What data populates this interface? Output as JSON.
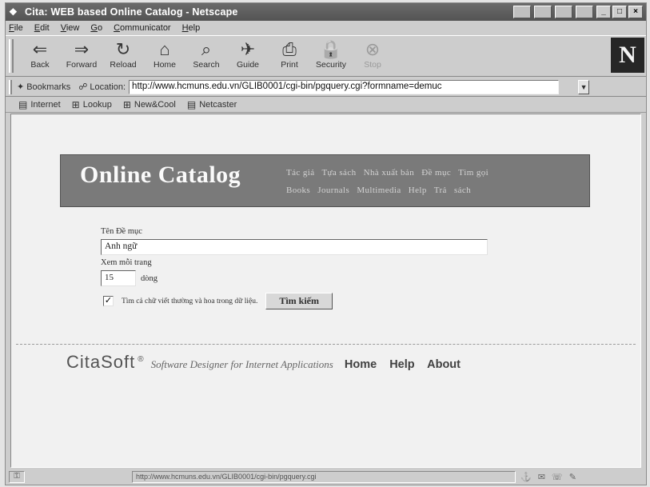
{
  "window": {
    "title": "Cita: WEB based Online Catalog - Netscape"
  },
  "menu": [
    "File",
    "Edit",
    "View",
    "Go",
    "Communicator",
    "Help"
  ],
  "toolbar": {
    "buttons": [
      {
        "label": "Back",
        "icon": "back-arrow-icon",
        "glyph": "⇐"
      },
      {
        "label": "Forward",
        "icon": "forward-arrow-icon",
        "glyph": "⇒"
      },
      {
        "label": "Reload",
        "icon": "reload-icon",
        "glyph": "↻"
      },
      {
        "label": "Home",
        "icon": "home-icon",
        "glyph": "⌂"
      },
      {
        "label": "Search",
        "icon": "search-icon",
        "glyph": "⌕"
      },
      {
        "label": "Guide",
        "icon": "guide-icon",
        "glyph": "✈"
      },
      {
        "label": "Print",
        "icon": "print-icon",
        "glyph": "⎙"
      },
      {
        "label": "Security",
        "icon": "lock-icon",
        "glyph": "🔒"
      },
      {
        "label": "Stop",
        "icon": "stop-icon",
        "glyph": "⊗"
      }
    ],
    "logo": "N"
  },
  "location": {
    "bookmarks_label": "Bookmarks",
    "location_label": "Location:",
    "url": "http://www.hcmuns.edu.vn/GLIB0001/cgi-bin/pgquery.cgi?formname=demuc"
  },
  "personal": [
    "Internet",
    "Lookup",
    "New&Cool",
    "Netcaster"
  ],
  "page": {
    "banner_title": "Online Catalog",
    "banner_links_row1": [
      "Tác giả",
      "Tựa sách",
      "Nhà xuất bản",
      "Đề mục",
      "Tìm gọi"
    ],
    "banner_links_row2": [
      "Books",
      "Journals",
      "Multimedia",
      "Help",
      "Trả",
      "sách"
    ],
    "field_label": "Tên Đề mục",
    "field_value": "Anh ngữ",
    "rows_label": "Xem mỗi trang",
    "rows_value": "15",
    "rows_unit": "dòng",
    "case_label": "Tìm cả chữ viết thường và hoa trong dữ liệu.",
    "case_checked": true,
    "search_button": "Tìm kiếm",
    "footer_brand": "CitaSoft",
    "footer_reg": "®",
    "footer_tagline": "Software Designer for Internet Applications",
    "footer_links": [
      "Home",
      "Help",
      "About"
    ]
  },
  "status": {
    "text": "http://www.hcmuns.edu.vn/GLIB0001/cgi-bin/pgquery.cgi"
  }
}
